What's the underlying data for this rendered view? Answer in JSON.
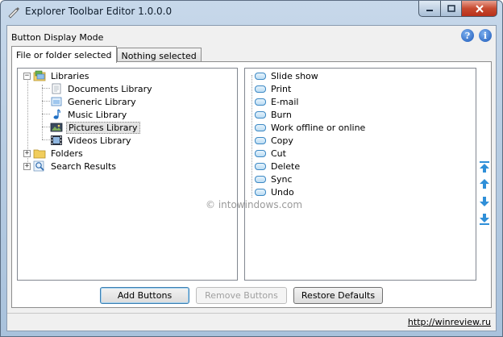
{
  "window": {
    "title": "Explorer Toolbar Editor 1.0.0.0"
  },
  "header": {
    "mode_label": "Button Display Mode"
  },
  "tabs": [
    {
      "label": "File or folder selected",
      "active": true
    },
    {
      "label": "Nothing selected",
      "active": false
    }
  ],
  "tree": {
    "libraries": {
      "label": "Libraries",
      "children": [
        "Documents Library",
        "Generic Library",
        "Music Library",
        "Pictures Library",
        "Videos Library"
      ]
    },
    "folders": "Folders",
    "search_results": "Search Results",
    "selected": "Pictures Library"
  },
  "button_items": [
    "Slide show",
    "Print",
    "E-mail",
    "Burn",
    "Work offline or online",
    "Copy",
    "Cut",
    "Delete",
    "Sync",
    "Undo"
  ],
  "actions": {
    "add": "Add Buttons",
    "remove": "Remove Buttons",
    "restore": "Restore Defaults"
  },
  "watermark": "© intowindows.com",
  "status": {
    "link": "http://winreview.ru"
  },
  "colors": {
    "accent": "#1a57b8",
    "arrow": "#2f8fd8"
  }
}
